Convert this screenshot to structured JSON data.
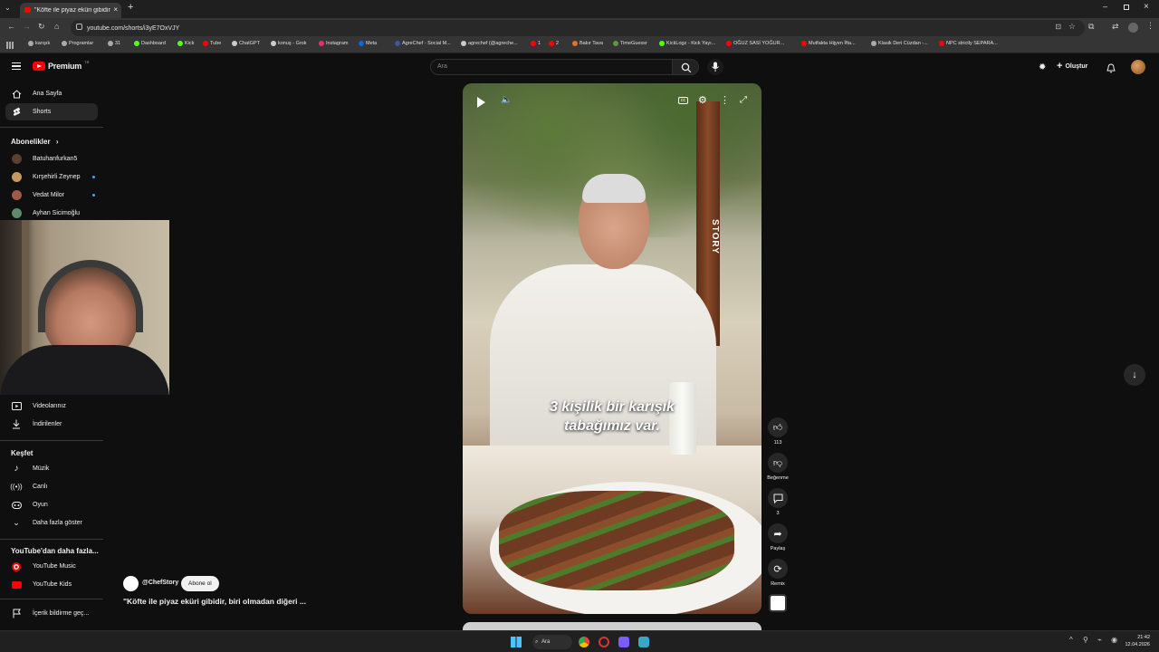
{
  "browser": {
    "tab_title": "\"Köfte ile piyaz eküri gibidir, bi",
    "url": "youtube.com/shorts/i3yE7OxVJY",
    "bookmarks": [
      "karışık",
      "Programlar",
      "31",
      "Dashboard",
      "Kick",
      "Tube",
      "ChatGPT",
      "konuş - Grok",
      "Instagram",
      "Meta",
      "AgreChef - Social M...",
      "agrechef (@agreche...",
      "1",
      "2",
      "Bakır Tava",
      "TimeGuessr",
      "KickLogz - Kick Yayı...",
      "OĞUZ SASİ YOĞUR...",
      "Mutfakta Hijyen İfta...",
      "Klasik Deri Cüzdan -...",
      "NPC strictly SEPARA..."
    ]
  },
  "youtube": {
    "logo_text": "Premium",
    "logo_badge": "TR",
    "search_placeholder": "Ara",
    "create_label": "Oluştur"
  },
  "sidebar": {
    "home": "Ana Sayfa",
    "shorts": "Shorts",
    "subscriptions_heading": "Abonelikler",
    "channels": [
      {
        "name": "Batuhanfurkan5",
        "color": "#5a4030",
        "new": false
      },
      {
        "name": "Kırşehirli Zeynep",
        "color": "#c49a60",
        "new": true
      },
      {
        "name": "Vedat Milor",
        "color": "#a05a4a",
        "new": true
      },
      {
        "name": "Ayhan Sicimoğlu",
        "color": "#5e8a6a",
        "new": false
      }
    ],
    "your_videos": "Videolarınız",
    "downloads": "İndirilenler",
    "explore_heading": "Keşfet",
    "explore": [
      "Müzik",
      "Canlı",
      "Oyun",
      "Daha fazla göster"
    ],
    "more_heading": "YouTube'dan daha fazla...",
    "more": [
      "YouTube Music",
      "YouTube Kids"
    ],
    "report": "İçerik bildirme geç..."
  },
  "video": {
    "subtitle_line1": "3 kişilik bir karışık",
    "subtitle_line2": "tabağımız var.",
    "watermark": "STORY",
    "channel": "@ChefStory",
    "subscribe": "Abone ol",
    "title": "\"Köfte ile piyaz eküri gibidir, biri olmadan diğeri ..."
  },
  "actions": {
    "likes": "113",
    "dislike": "Beğenme",
    "comments": "3",
    "share": "Paylaş",
    "remix": "Remix"
  },
  "taskbar": {
    "search": "Ara",
    "time": "21:42",
    "date": "12.04.2026"
  }
}
